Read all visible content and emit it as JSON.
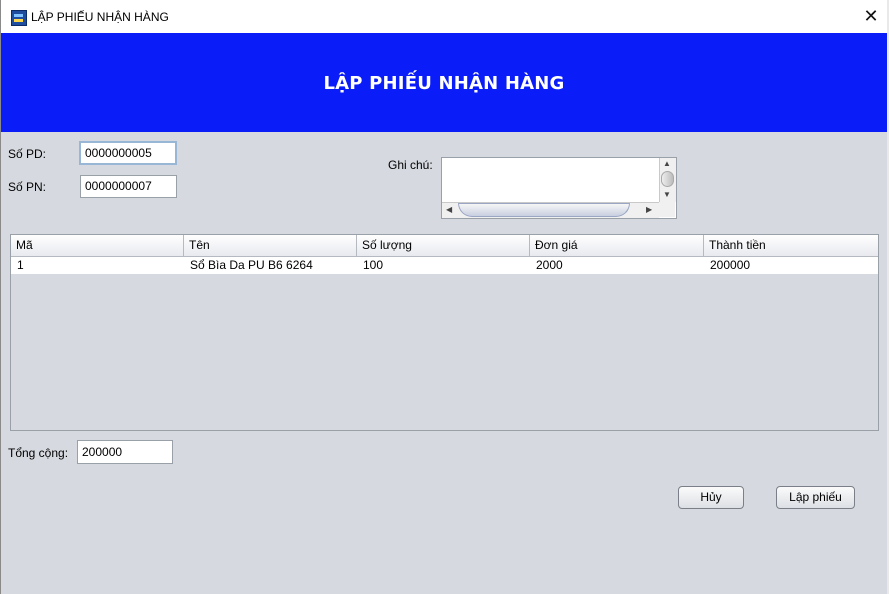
{
  "window": {
    "title": "LẬP PHIẾU NHẬN HÀNG",
    "close_glyph": "✕"
  },
  "header": {
    "title": "LẬP PHIẾU NHẬN HÀNG",
    "background": "#0a1cf7"
  },
  "form": {
    "so_pd": {
      "label": "Số PD:",
      "value": "0000000005"
    },
    "so_pn": {
      "label": "Số PN:",
      "value": "0000000007"
    },
    "ghi_chu": {
      "label": "Ghi chú:",
      "value": ""
    }
  },
  "table": {
    "columns": [
      "Mã",
      "Tên",
      "Số lượng",
      "Đơn giá",
      "Thành tiền"
    ],
    "rows": [
      [
        "1",
        "Sổ Bìa Da PU B6 6264",
        "100",
        "2000",
        "200000"
      ]
    ]
  },
  "total": {
    "label": "Tổng cộng:",
    "value": "200000"
  },
  "buttons": {
    "cancel": "Hủy",
    "create": "Lập phiếu"
  },
  "icons": {
    "app": "app-icon",
    "close": "close-icon"
  }
}
